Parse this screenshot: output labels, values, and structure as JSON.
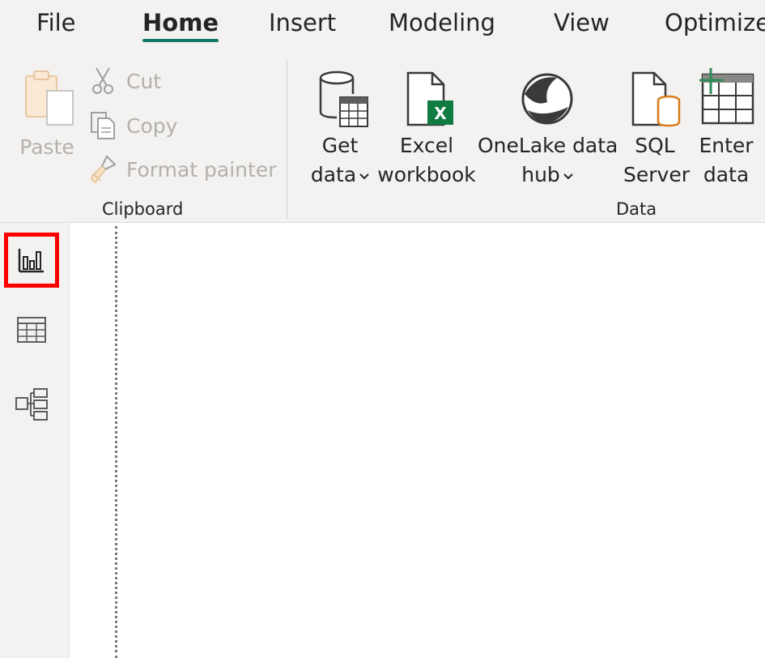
{
  "tabs": [
    {
      "label": "File",
      "active": false
    },
    {
      "label": "Home",
      "active": true
    },
    {
      "label": "Insert",
      "active": false
    },
    {
      "label": "Modeling",
      "active": false
    },
    {
      "label": "View",
      "active": false
    },
    {
      "label": "Optimize",
      "active": false
    }
  ],
  "clipboard": {
    "group_label": "Clipboard",
    "paste_label": "Paste",
    "cut_label": "Cut",
    "copy_label": "Copy",
    "format_painter_label": "Format painter"
  },
  "data_group": {
    "group_label": "Data",
    "get_data": {
      "line1": "Get",
      "line2": "data"
    },
    "excel": {
      "line1": "Excel",
      "line2": "workbook"
    },
    "onelake": {
      "line1": "OneLake data",
      "line2": "hub"
    },
    "sql": {
      "line1": "SQL",
      "line2": "Server"
    },
    "enter": {
      "line1": "Enter",
      "line2": "data"
    }
  },
  "rail": {
    "selected": "report-view",
    "items": [
      "report-view",
      "table-view",
      "model-view"
    ]
  },
  "colors": {
    "accent": "#117865",
    "excel_green": "#107c41",
    "sql_orange": "#d87a16",
    "highlight_red": "#ff0000"
  }
}
